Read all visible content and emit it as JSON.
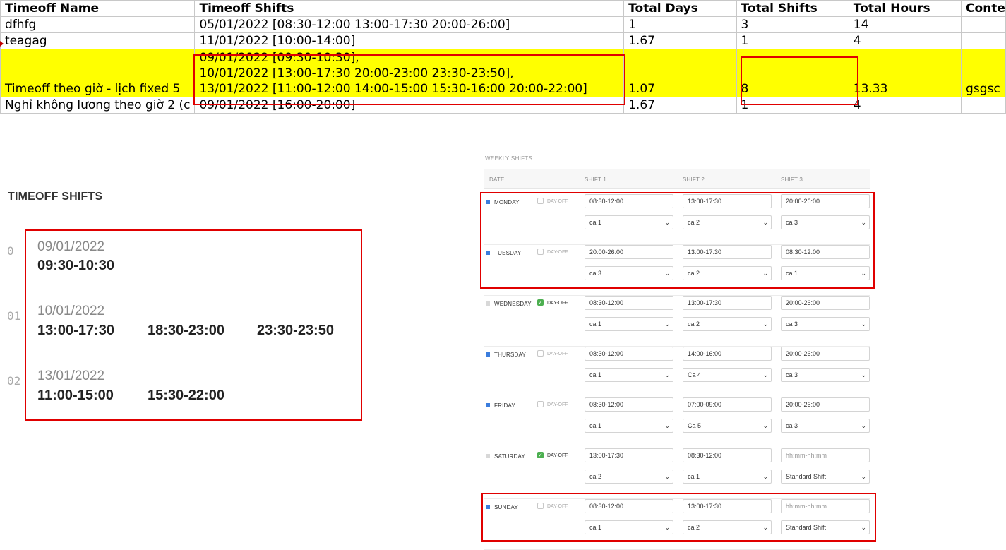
{
  "sheet": {
    "headers": [
      "Timeoff Name",
      "Timeoff Shifts",
      "Total Days",
      "Total Shifts",
      "Total Hours",
      "Conte"
    ],
    "rows": [
      [
        "dfhfg",
        "05/01/2022 [08:30-12:00 13:00-17:30 20:00-26:00]",
        "1",
        "3",
        "14",
        ""
      ],
      [
        "teagag",
        "11/01/2022 [10:00-14:00]",
        "1.67",
        "1",
        "4",
        ""
      ],
      [
        "Timeoff theo giờ - lịch fixed 5",
        "09/01/2022 [09:30-10:30],\n10/01/2022 [13:00-17:30 20:00-23:00 23:30-23:50],\n13/01/2022 [11:00-12:00 14:00-15:00 15:30-16:00 20:00-22:00]",
        "1.07",
        "8",
        "13.33",
        "gsgsc"
      ],
      [
        "Nghỉ không lương theo giờ 2 (c",
        "09/01/2022 [16:00-20:00]",
        "1.67",
        "1",
        "4",
        ""
      ]
    ]
  },
  "timeoff": {
    "title": "TIMEOFF SHIFTS",
    "entries": [
      {
        "index": "0",
        "date": "09/01/2022",
        "shifts": [
          "09:30-10:30"
        ]
      },
      {
        "index": "01",
        "date": "10/01/2022",
        "shifts": [
          "13:00-17:30",
          "18:30-23:00",
          "23:30-23:50"
        ]
      },
      {
        "index": "02",
        "date": "13/01/2022",
        "shifts": [
          "11:00-15:00",
          "15:30-22:00"
        ]
      }
    ]
  },
  "weekly": {
    "title": "WEEKLY SHIFTS",
    "headers": {
      "date": "DATE",
      "shift1": "SHIFT 1",
      "shift2": "SHIFT 2",
      "shift3": "SHIFT 3"
    },
    "dayoff_label": "DAY-OFF",
    "days": [
      {
        "name": "MONDAY",
        "active": true,
        "dayoff": false,
        "times": [
          "08:30-12:00",
          "13:00-17:30",
          "20:00-26:00"
        ],
        "types": [
          "ca 1",
          "ca 2",
          "ca 3"
        ]
      },
      {
        "name": "TUESDAY",
        "active": true,
        "dayoff": false,
        "times": [
          "20:00-26:00",
          "13:00-17:30",
          "08:30-12:00"
        ],
        "types": [
          "ca 3",
          "ca 2",
          "ca 1"
        ]
      },
      {
        "name": "WEDNESDAY",
        "active": false,
        "dayoff": true,
        "times": [
          "08:30-12:00",
          "13:00-17:30",
          "20:00-26:00"
        ],
        "types": [
          "ca 1",
          "ca 2",
          "ca 3"
        ]
      },
      {
        "name": "THURSDAY",
        "active": true,
        "dayoff": false,
        "times": [
          "08:30-12:00",
          "14:00-16:00",
          "20:00-26:00"
        ],
        "types": [
          "ca 1",
          "Ca 4",
          "ca 3"
        ]
      },
      {
        "name": "FRIDAY",
        "active": true,
        "dayoff": false,
        "times": [
          "08:30-12:00",
          "07:00-09:00",
          "20:00-26:00"
        ],
        "types": [
          "ca 1",
          "Ca 5",
          "ca 3"
        ]
      },
      {
        "name": "SATURDAY",
        "active": false,
        "dayoff": true,
        "times": [
          "13:00-17:30",
          "08:30-12:00",
          ""
        ],
        "types": [
          "ca 2",
          "ca 1",
          "Standard Shift"
        ]
      },
      {
        "name": "SUNDAY",
        "active": true,
        "dayoff": false,
        "times": [
          "08:30-12:00",
          "13:00-17:30",
          ""
        ],
        "types": [
          "ca 1",
          "ca 2",
          "Standard Shift"
        ]
      }
    ],
    "time_placeholder": "hh:mm-hh:mm"
  },
  "colors": {
    "highlight": "#ffff00",
    "annotation": "#e00000",
    "active_dot": "#3b7ddd",
    "dayoff_check": "#4caf50"
  }
}
